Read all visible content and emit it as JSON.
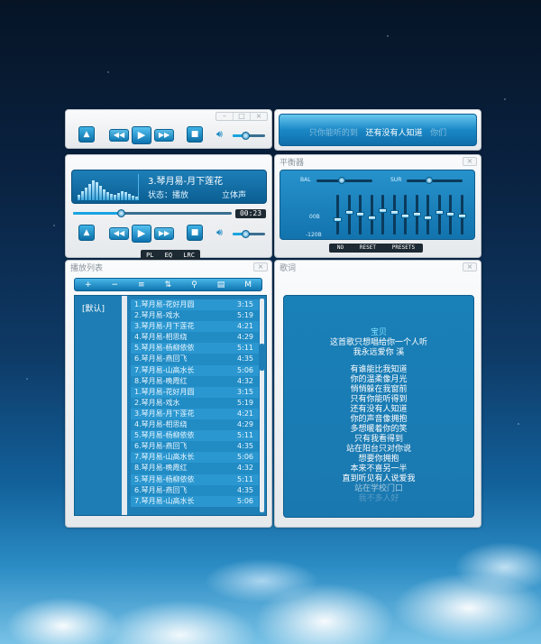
{
  "controls": {
    "open_icon": "▲",
    "prev_icon": "◀◀",
    "play_icon": "▶",
    "next_icon": "▶▶",
    "stop_icon": "■",
    "volume_icon": "speaker-icon",
    "volume_level": 0.4,
    "progress_level": 0.3
  },
  "lyric_bar": {
    "prev_text": "只你能听的到",
    "current_text": "还有没有人知道",
    "next_text": "你们"
  },
  "player": {
    "song_title": "3.琴月易-月下莲花",
    "status_label": "状态：播放",
    "channel_label": "立体声",
    "time": "00:23",
    "buttons": [
      "PL",
      "EQ",
      "LRC"
    ]
  },
  "equalizer": {
    "title": "平衡器",
    "bal_label": "BAL",
    "sur_label": "SUR",
    "db_top": "00B",
    "db_bottom": "-120B",
    "bottom_buttons": [
      "NO",
      "RESET",
      "PRESETS"
    ],
    "bal_level": 0.45,
    "sur_level": 0.4,
    "bands": [
      0.35,
      0.55,
      0.5,
      0.4,
      0.6,
      0.55,
      0.45,
      0.5,
      0.4,
      0.55,
      0.5,
      0.45
    ]
  },
  "playlist": {
    "title": "播放列表",
    "toolbar": [
      "+",
      "−",
      "≡",
      "⇅",
      "⚲",
      "▤",
      "M"
    ],
    "default_list": "[默认]",
    "tracks": [
      {
        "name": "1.琴月易-花好月圆",
        "duration": "3:15"
      },
      {
        "name": "2.琴月易-戏水",
        "duration": "5:19"
      },
      {
        "name": "3.琴月易-月下莲花",
        "duration": "4:21"
      },
      {
        "name": "4.琴月易-相思绕",
        "duration": "4:29"
      },
      {
        "name": "5.琴月易-杨柳依依",
        "duration": "5:11"
      },
      {
        "name": "6.琴月易-燕回飞",
        "duration": "4:35"
      },
      {
        "name": "7.琴月易-山高水长",
        "duration": "5:06"
      },
      {
        "name": "8.琴月易-晚霞红",
        "duration": "4:32"
      },
      {
        "name": "1.琴月易-花好月圆",
        "duration": "3:15"
      },
      {
        "name": "2.琴月易-戏水",
        "duration": "5:19"
      },
      {
        "name": "3.琴月易-月下莲花",
        "duration": "4:21"
      },
      {
        "name": "4.琴月易-相思绕",
        "duration": "4:29"
      },
      {
        "name": "5.琴月易-杨柳依依",
        "duration": "5:11"
      },
      {
        "name": "6.琴月易-燕回飞",
        "duration": "4:35"
      },
      {
        "name": "7.琴月易-山高水长",
        "duration": "5:06"
      },
      {
        "name": "8.琴月易-晚霞红",
        "duration": "4:32"
      },
      {
        "name": "5.琴月易-杨柳依依",
        "duration": "5:11"
      },
      {
        "name": "6.琴月易-燕回飞",
        "duration": "4:35"
      },
      {
        "name": "7.琴月易-山高水长",
        "duration": "5:06"
      }
    ]
  },
  "lyrics": {
    "title": "歌词",
    "lines": [
      {
        "text": "宝贝",
        "hl": true
      },
      {
        "text": "这首歌只想唱给你一个人听",
        "hl": false
      },
      {
        "text": "我永远爱你  溪",
        "hl": false
      },
      {
        "text": "",
        "hl": false
      },
      {
        "text": "有谁能比我知道",
        "hl": false
      },
      {
        "text": "你的温柔像月光",
        "hl": false
      },
      {
        "text": "悄悄躲在我窗前",
        "hl": false
      },
      {
        "text": "只有你能听得到",
        "hl": false
      },
      {
        "text": "还有没有人知道",
        "hl": false
      },
      {
        "text": "你的声音像拥抱",
        "hl": false
      },
      {
        "text": "多想暖着你的笑",
        "hl": false
      },
      {
        "text": "只有我看得到",
        "hl": false
      },
      {
        "text": "站在阳台只对你说",
        "hl": false
      },
      {
        "text": "想要你拥抱",
        "hl": false
      },
      {
        "text": "本来不喜另一半",
        "hl": false
      },
      {
        "text": "直到听见有人说爱我",
        "hl": false
      },
      {
        "text": "站在学校门口",
        "hl": false
      },
      {
        "text": "我不多人好",
        "hl": false
      }
    ]
  }
}
